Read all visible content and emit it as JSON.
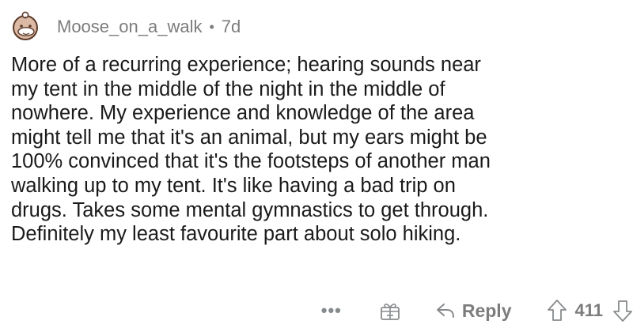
{
  "comment": {
    "username": "Moose_on_a_walk",
    "separator": "•",
    "age": "7d",
    "body_lines": [
      "More of a recurring experience; hearing sounds near",
      "my tent in the middle of the night in the middle of",
      "nowhere. My experience and knowledge of the area",
      "might tell me that it's an animal, but my ears might be",
      "100% convinced that it's the footsteps of another man",
      "walking up to my tent. It's like having a bad trip on",
      "drugs. Takes some mental gymnastics to get through.",
      "Definitely my least favourite part about solo hiking."
    ]
  },
  "actions": {
    "more": "•••",
    "award_icon": "gift-icon",
    "reply_icon": "reply-arrow-icon",
    "reply_label": "Reply",
    "upvote_icon": "upvote-arrow-icon",
    "score": "411",
    "downvote_icon": "downvote-arrow-icon"
  },
  "colors": {
    "text": "#1a1a1b",
    "meta": "#7c7c7c",
    "icon": "#878a8c",
    "avatar_face": "#d8b6a2",
    "avatar_outline": "#5c3a2a"
  }
}
